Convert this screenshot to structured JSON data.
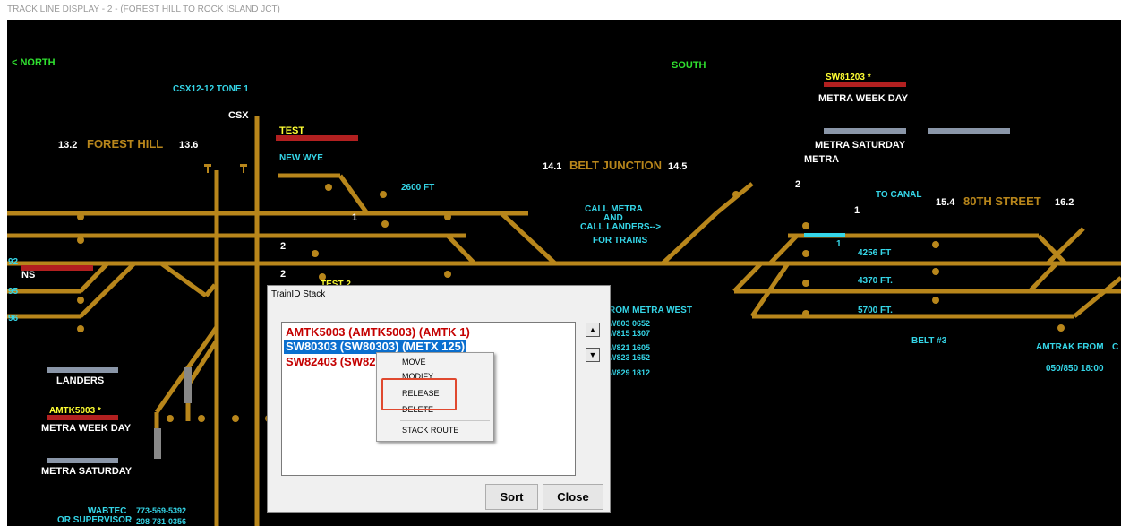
{
  "window": {
    "title": "TRACK LINE DISPLAY - 2 - (FOREST HILL TO ROCK ISLAND JCT)"
  },
  "labels": {
    "north": "< NORTH",
    "south": "SOUTH",
    "csx_tone": "CSX12-12 TONE 1",
    "csx": "CSX",
    "forest_hill_left": "13.2",
    "forest_hill": "FOREST HILL",
    "forest_hill_right": "13.6",
    "test": "TEST",
    "new_wye": "NEW WYE",
    "ft_2600": "2600 FT",
    "belt_left": "14.1",
    "belt_junction": "BELT JUNCTION",
    "belt_right": "14.5",
    "call_metra_1": "CALL METRA",
    "call_metra_2": "AND",
    "call_metra_3": "CALL LANDERS-->",
    "call_metra_4": "FOR TRAINS",
    "sw81203": "SW81203 *",
    "metra_week_day_top": "METRA WEEK DAY",
    "metra_saturday_top": "METRA SATURDAY",
    "metra": "METRA",
    "to_canal": "TO CANAL",
    "st80_left": "15.4",
    "st80": "80TH STREET",
    "st80_right": "16.2",
    "ft_4256": "4256 FT",
    "ft_4370": "4370 FT.",
    "ft_5700": "5700 FT.",
    "belt3": "BELT #3",
    "amtrak_from": "AMTRAK FROM",
    "amtrak_c": "C",
    "amtrak_time": "050/850 18:00",
    "from_metra_west": "ROM METRA WEST",
    "sched_1": "W803  0652",
    "sched_2": "W815  1307",
    "sched_3": "W821  1605",
    "sched_4": "W823  1652",
    "sched_5": "W829  1812",
    "test2": "TEST 2",
    "ns": "NS",
    "trk92": "92",
    "trk95": "95",
    "trk96": "96",
    "landers": "LANDERS",
    "amtk5003": "AMTK5003 *",
    "metra_week_day": "METRA WEEK DAY",
    "metra_saturday": "METRA SATURDAY",
    "wabtec": "WABTEC",
    "wabtec_phone": "773-569-5392",
    "supervisor": "OR SUPERVISOR",
    "supervisor_phone": "208-781-0356",
    "n1a": "1",
    "n1b": "1",
    "n2a": "2",
    "n2b": "2",
    "n2c": "2",
    "n1t": "1"
  },
  "dialog": {
    "title": "TrainID Stack",
    "items": [
      "AMTK5003 (AMTK5003) (AMTK    1)",
      "SW80303 (SW80303) (METX   125)",
      "SW82403 (SW82"
    ],
    "sort_label": "Sort",
    "close_label": "Close",
    "up_glyph": "▲",
    "down_glyph": "▼"
  },
  "context_menu": {
    "items": [
      "MOVE",
      "MODIFY",
      "RELEASE",
      "DELETE",
      "STACK ROUTE"
    ],
    "highlighted": "RELEASE"
  },
  "colors": {
    "track": "#b8861b",
    "green_label": "#2fe02f",
    "cyan_label": "#35d6e8",
    "yellow_label": "#ffff33",
    "red_block": "#b22020",
    "grey_block": "#8a96a8",
    "selection": "#0a6fcf",
    "highlight_box": "#e0492f"
  }
}
